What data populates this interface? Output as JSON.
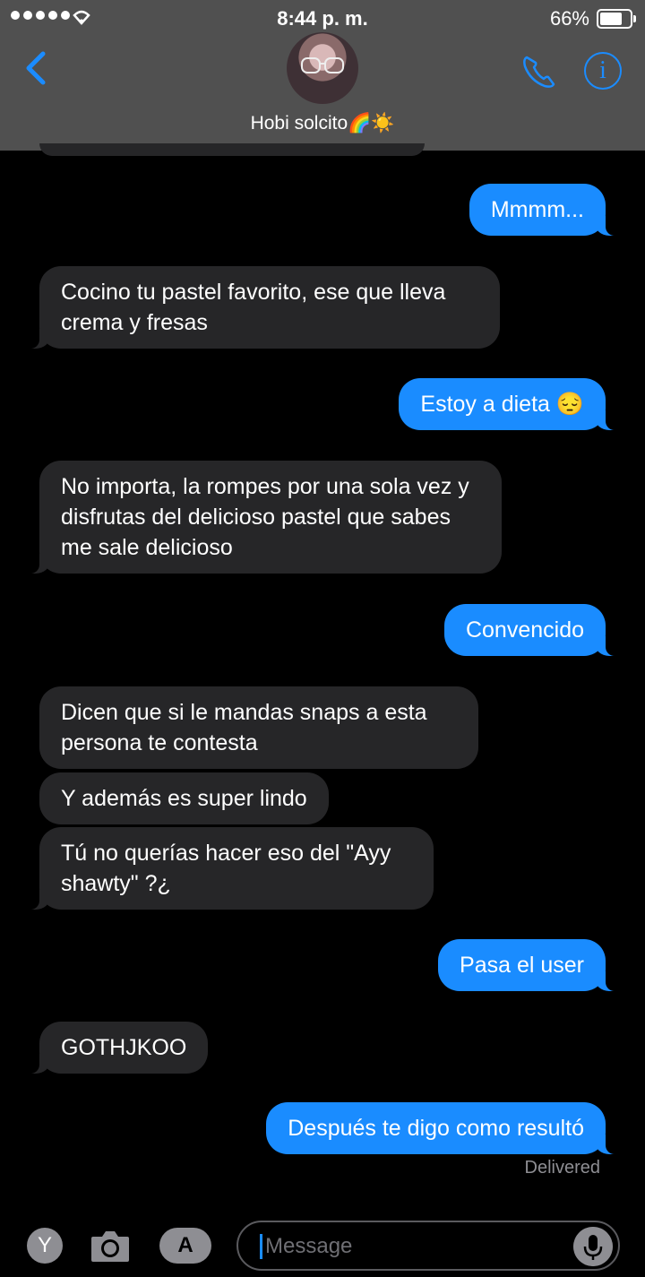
{
  "status_bar": {
    "time": "8:44 p. m.",
    "battery_percent": "66%",
    "battery_level": 0.66
  },
  "header": {
    "contact_name": "Hobi solcito🌈☀️",
    "avatar_icon": "avatar-photo"
  },
  "messages": [
    {
      "side": "out",
      "text": "Mmmm..."
    },
    {
      "side": "in",
      "text": "Cocino tu pastel favorito, ese que lleva crema y fresas"
    },
    {
      "side": "out",
      "text": "Estoy a dieta 😔"
    },
    {
      "side": "in",
      "text": "No importa, la rompes por una sola vez y disfrutas del delicioso pastel que sabes me sale delicioso"
    },
    {
      "side": "out",
      "text": "Convencido"
    },
    {
      "side": "in",
      "text": "Dicen que si le mandas snaps a esta persona te contesta"
    },
    {
      "side": "in",
      "text": "Y además es super lindo"
    },
    {
      "side": "in",
      "text": "Tú no querías hacer eso del \"Ayy shawty\" ?¿"
    },
    {
      "side": "out",
      "text": "Pasa el user"
    },
    {
      "side": "in",
      "text": "GOTHJKOO"
    },
    {
      "side": "out",
      "text": "Después te digo como resultó"
    }
  ],
  "delivered_label": "Delivered",
  "input": {
    "placeholder": "Message",
    "app_y_label": "Y",
    "appstore_label": "A"
  },
  "colors": {
    "outgoing": "#1a8cff",
    "incoming": "#262628",
    "header": "#505050",
    "accent": "#1b8cff"
  }
}
